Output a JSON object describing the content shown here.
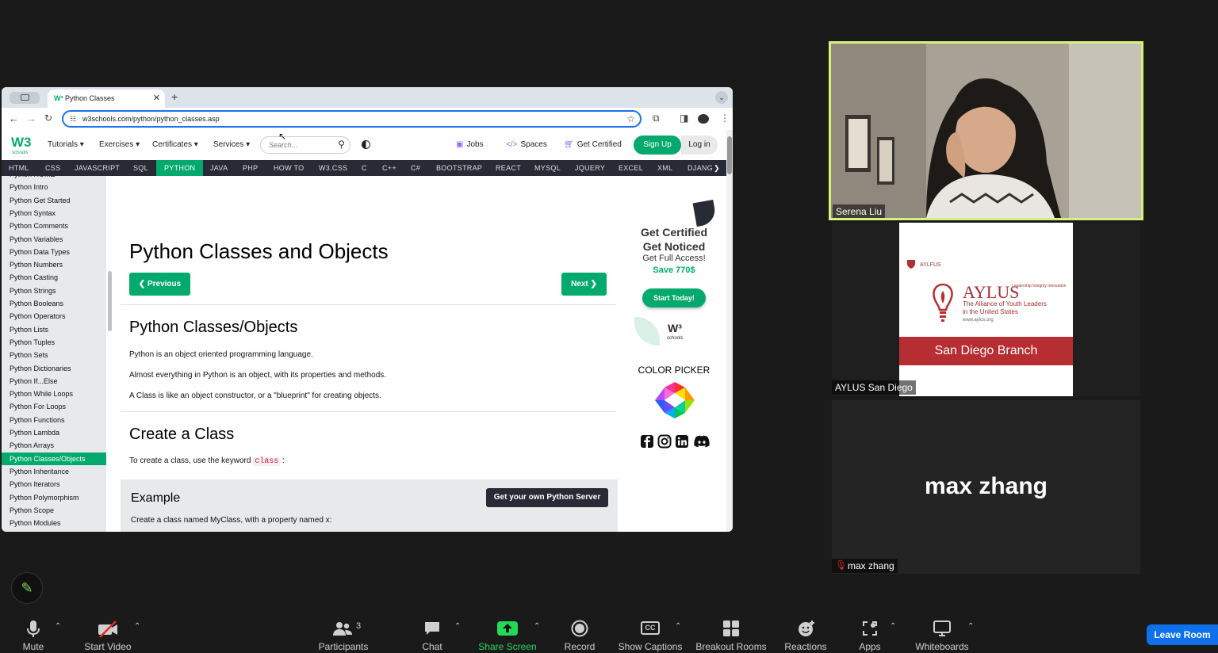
{
  "browser": {
    "tab_title": "Python Classes",
    "tab_favicon": "W³",
    "new_tab": "+",
    "url": "w3schools.com/python/python_classes.asp"
  },
  "w3nav": {
    "logo": "W3",
    "logo_sub": "schools",
    "menus": [
      "Tutorials ▾",
      "Exercises ▾",
      "Certificates ▾",
      "Services ▾"
    ],
    "search_placeholder": "Search...",
    "links": [
      "Jobs",
      "Spaces",
      "Get Certified"
    ],
    "signup": "Sign Up",
    "login": "Log in"
  },
  "topics": [
    "HTML",
    "CSS",
    "JAVASCRIPT",
    "SQL",
    "PYTHON",
    "JAVA",
    "PHP",
    "HOW TO",
    "W3.CSS",
    "C",
    "C++",
    "C#",
    "BOOTSTRAP",
    "REACT",
    "MYSQL",
    "JQUERY",
    "EXCEL",
    "XML",
    "DJANG"
  ],
  "topic_next": "❯",
  "sidebar": {
    "items": [
      "Python HOME",
      "Python Intro",
      "Python Get Started",
      "Python Syntax",
      "Python Comments",
      "Python Variables",
      "Python Data Types",
      "Python Numbers",
      "Python Casting",
      "Python Strings",
      "Python Booleans",
      "Python Operators",
      "Python Lists",
      "Python Tuples",
      "Python Sets",
      "Python Dictionaries",
      "Python If...Else",
      "Python While Loops",
      "Python For Loops",
      "Python Functions",
      "Python Lambda",
      "Python Arrays",
      "Python Classes/Objects",
      "Python Inheritance",
      "Python Iterators",
      "Python Polymorphism",
      "Python Scope",
      "Python Modules"
    ],
    "active_index": 22
  },
  "main": {
    "title": "Python Classes and Objects",
    "prev": "❮ Previous",
    "next": "Next ❯",
    "section1_title": "Python Classes/Objects",
    "p1": "Python is an object oriented programming language.",
    "p2": "Almost everything in Python is an object, with its properties and methods.",
    "p3": "A Class is like an object constructor, or a \"blueprint\" for creating objects.",
    "section2_title": "Create a Class",
    "p4_prefix": "To create a class, use the keyword",
    "p4_keyword": "class",
    "p4_suffix": ":",
    "example_title": "Example",
    "example_button": "Get your own Python Server",
    "example_text": "Create a class named MyClass, with a property named x:"
  },
  "ad": {
    "line1": "Get Certified",
    "line2": "Get Noticed",
    "line3": "Get Full Access!",
    "line4": "Save 770$",
    "button": "Start Today!",
    "w3": "W³",
    "w3sub": "schools",
    "color_picker": "COLOR PICKER"
  },
  "participants": {
    "serena": "Serena Liu",
    "aylus_tile": "AYLUS San Diego",
    "max_display": "max zhang",
    "max_tag": "max zhang"
  },
  "aylus_card": {
    "small": "AYLFUS",
    "big": "AYLUS",
    "tiny": "Leadership Integrity Innovation",
    "sub": "The Alliance of Youth Leaders in the United States",
    "url": "www.aylus.org",
    "band": "San Diego Branch"
  },
  "controls": {
    "mute": "Mute",
    "video": "Start Video",
    "participants": "Participants",
    "participant_count": "3",
    "chat": "Chat",
    "share": "Share Screen",
    "record": "Record",
    "captions": "Show Captions",
    "captions_icon": "CC",
    "breakout": "Breakout Rooms",
    "reactions": "Reactions",
    "apps": "Apps",
    "whiteboards": "Whiteboards",
    "leave": "Leave Room"
  },
  "colors": {
    "w3_green": "#04aa6d",
    "topic_bar": "#282a35",
    "speaker_border": "#d5f27a",
    "share_green": "#23d959",
    "leave_blue": "#0e71eb",
    "aylus_red": "#b62e31"
  }
}
